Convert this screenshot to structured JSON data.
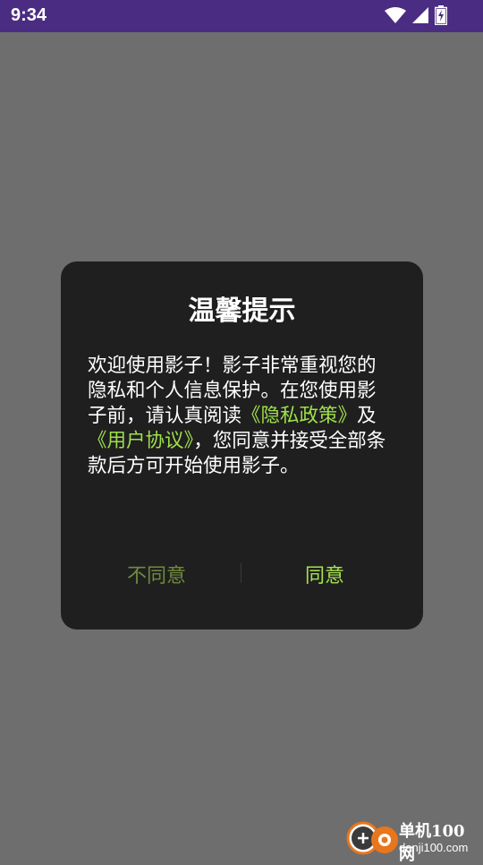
{
  "status_bar": {
    "time": "9:34",
    "icons": [
      "wifi-icon",
      "signal-icon",
      "battery-charging-icon"
    ]
  },
  "dialog": {
    "title": "温馨提示",
    "message_parts": {
      "intro": "欢迎使用影子！影子非常重视您的隐私和个人信息保护。在您使用影子前，请认真阅读",
      "privacy_link": "《隐私政策》",
      "and": "及",
      "agreement_link": "《用户协议》",
      "outro": "，您同意并接受全部条款后方可开始使用影子。"
    },
    "disagree_label": "不同意",
    "agree_label": "同意"
  },
  "colors": {
    "status_bar_bg": "#4a2d82",
    "overlay_bg": "#6e6e6e",
    "dialog_bg": "#1f1f1f",
    "link_color": "#9fe04a"
  },
  "watermark": {
    "line1": "单机100网",
    "line2": "danji100.com"
  }
}
